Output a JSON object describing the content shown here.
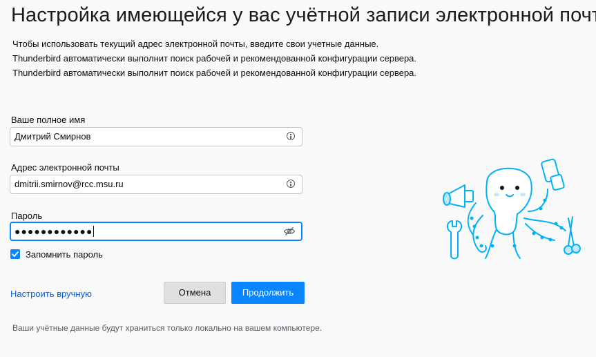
{
  "page": {
    "title": "Настройка имеющейся у вас учётной записи электронной почты",
    "description": [
      "Чтобы использовать текущий адрес электронной почты, введите свои учетные данные.",
      "Thunderbird автоматически выполнит поиск рабочей и рекомендованной конфигурации сервера.",
      "Thunderbird автоматически выполнит поиск рабочей и рекомендованной конфигурации сервера."
    ]
  },
  "form": {
    "name_label": "Ваше полное имя",
    "name_value": "Дмитрий Смирнов",
    "email_label": "Адрес электронной почты",
    "email_value": "dmitrii.smirnov@rcc.msu.ru",
    "password_label": "Пароль",
    "password_value": "●●●●●●●●●●●●",
    "remember_label": "Запомнить пароль",
    "remember_checked": true
  },
  "actions": {
    "manual_label": "Настроить вручную",
    "cancel_label": "Отмена",
    "continue_label": "Продолжить"
  },
  "footer": {
    "note": "Ваши учётные данные будут храниться только локально на вашем компьютере."
  },
  "icons": {
    "name_field": "info-icon",
    "email_field": "info-icon",
    "password_field": "eye-slash-icon",
    "illustration": "octopus-mascot-illustration"
  },
  "colors": {
    "accent": "#0a84ff",
    "link": "#0060df",
    "background": "#f9f9fa",
    "mascot_outline": "#00b3f4"
  }
}
